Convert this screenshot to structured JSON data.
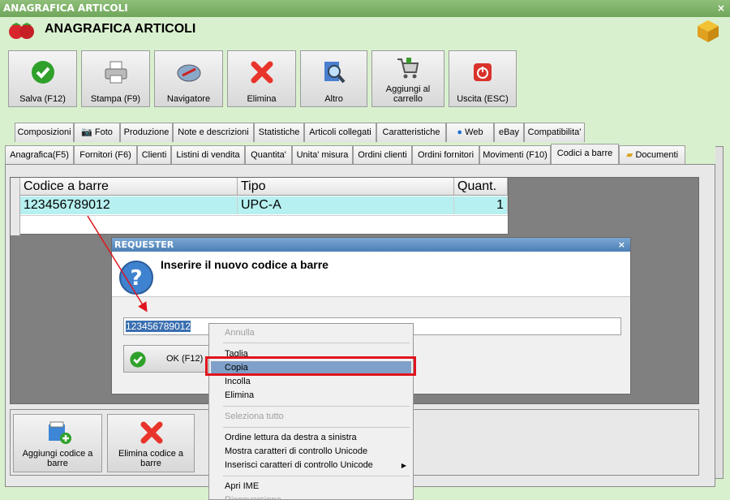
{
  "window": {
    "title": "ANAGRAFICA ARTICOLI",
    "close": "×"
  },
  "header": {
    "title": "ANAGRAFICA ARTICOLI"
  },
  "toolbar": [
    {
      "label": "Salva (F12)",
      "icon": "check-icon"
    },
    {
      "label": "Stampa (F9)",
      "icon": "printer-icon"
    },
    {
      "label": "Navigatore",
      "icon": "compass-icon"
    },
    {
      "label": "Elimina",
      "icon": "delete-x-icon"
    },
    {
      "label": "Altro",
      "icon": "search-magnifier-icon"
    },
    {
      "label": "Aggiungi al carrello",
      "icon": "cart-icon"
    },
    {
      "label": "Uscita (ESC)",
      "icon": "power-icon"
    }
  ],
  "tabs_row1": [
    "Composizioni",
    "Foto",
    "Produzione",
    "Note e descrizioni",
    "Statistiche",
    "Articoli collegati",
    "Caratteristiche",
    "Web",
    "eBay",
    "Compatibilita'"
  ],
  "tabs_row2": [
    "Anagrafica(F5)",
    "Fornitori (F6)",
    "Clienti",
    "Listini di vendita",
    "Quantita'",
    "Unita' misura",
    "Ordini clienti",
    "Ordini fornitori",
    "Movimenti (F10)",
    "Codici a barre",
    "Documenti"
  ],
  "grid": {
    "columns": [
      "Codice a barre",
      "Tipo",
      "Quant."
    ],
    "rows": [
      {
        "code": "123456789012",
        "type": "UPC-A",
        "qty": "1"
      }
    ]
  },
  "bottom_buttons": [
    {
      "label": "Aggiungi codice a barre",
      "icon": "add-barcode-icon"
    },
    {
      "label": "Elimina codice a barre",
      "icon": "delete-x-icon"
    }
  ],
  "dialog": {
    "title": "REQUESTER",
    "close": "×",
    "prompt": "Inserire il nuovo codice a barre",
    "value": "123456789012",
    "ok_label": "OK (F12)"
  },
  "context_menu": {
    "items": [
      {
        "label": "Annulla",
        "disabled": true
      },
      {
        "label": "Taglia"
      },
      {
        "label": "Copia",
        "highlighted": true
      },
      {
        "label": "Incolla"
      },
      {
        "label": "Elimina"
      },
      {
        "label": "Seleziona tutto",
        "disabled": true
      },
      {
        "label": "Ordine lettura da destra a sinistra"
      },
      {
        "label": "Mostra caratteri di controllo Unicode"
      },
      {
        "label": "Inserisci caratteri di controllo Unicode",
        "submenu": true
      },
      {
        "label": "Apri IME"
      },
      {
        "label": "Riconversione",
        "disabled": true
      }
    ]
  },
  "colors": {
    "accent_highlight": "#e0141d",
    "window_bg": "#d9f0cf",
    "selected_row": "#b7f0f0"
  }
}
